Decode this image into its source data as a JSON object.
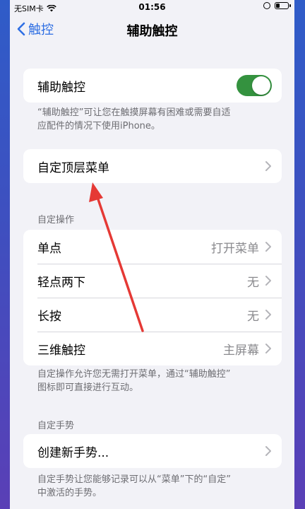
{
  "status_bar": {
    "carrier": "无SIM卡",
    "time": "01:56"
  },
  "nav": {
    "back_label": "触控",
    "title": "辅助触控"
  },
  "assistive_touch": {
    "label": "辅助触控",
    "enabled": true,
    "footer_line1": "“辅助触控”可让您在触摸屏幕有困难或需要自适",
    "footer_line2": "应配件的情况下使用iPhone。"
  },
  "top_menu": {
    "label": "自定顶层菜单"
  },
  "custom_actions": {
    "header": "自定操作",
    "rows": [
      {
        "label": "单点",
        "value": "打开菜单"
      },
      {
        "label": "轻点两下",
        "value": "无"
      },
      {
        "label": "长按",
        "value": "无"
      },
      {
        "label": "三维触控",
        "value": "主屏幕"
      }
    ],
    "footer_line1": "自定操作允许您无需打开菜单，通过“辅助触控”",
    "footer_line2": "图标即可直接进行互动。"
  },
  "custom_gestures": {
    "header": "自定手势",
    "create_label": "创建新手势...",
    "footer_line1": "自定手势让您能够记录可以从“菜单”下的“自定”",
    "footer_line2": "中激活的手势。"
  },
  "colors": {
    "accent": "#2f6fe3",
    "toggle_on": "#34923f",
    "annotation_arrow": "#e53935"
  }
}
